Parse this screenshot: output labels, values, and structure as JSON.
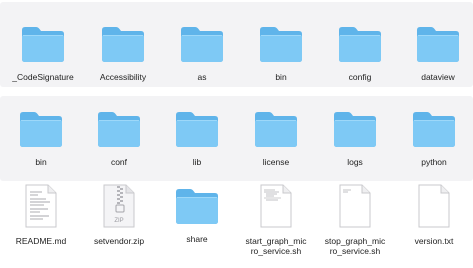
{
  "rows": [
    {
      "items": [
        {
          "label": "_CodeSignature",
          "type": "folder"
        },
        {
          "label": "Accessibility",
          "type": "folder"
        },
        {
          "label": "as",
          "type": "folder"
        },
        {
          "label": "bin",
          "type": "folder"
        },
        {
          "label": "config",
          "type": "folder"
        },
        {
          "label": "dataview",
          "type": "folder"
        }
      ]
    },
    {
      "items": [
        {
          "label": "bin",
          "type": "folder"
        },
        {
          "label": "conf",
          "type": "folder"
        },
        {
          "label": "lib",
          "type": "folder"
        },
        {
          "label": "license",
          "type": "folder"
        },
        {
          "label": "logs",
          "type": "folder"
        },
        {
          "label": "python",
          "type": "folder"
        }
      ]
    },
    {
      "items": [
        {
          "label": "README.md",
          "type": "text-file"
        },
        {
          "label": "setvendor.zip",
          "type": "zip-file"
        },
        {
          "label": "share",
          "type": "folder"
        },
        {
          "label": "start_graph_micro_service.sh",
          "type": "script-file"
        },
        {
          "label": "stop_graph_micro_service.sh",
          "type": "script-file"
        },
        {
          "label": "version.txt",
          "type": "blank-file"
        }
      ]
    }
  ],
  "colors": {
    "folder_back": "#5fb4ea",
    "folder_front": "#7ec9f5",
    "selection_row": "#f3f3f5"
  }
}
